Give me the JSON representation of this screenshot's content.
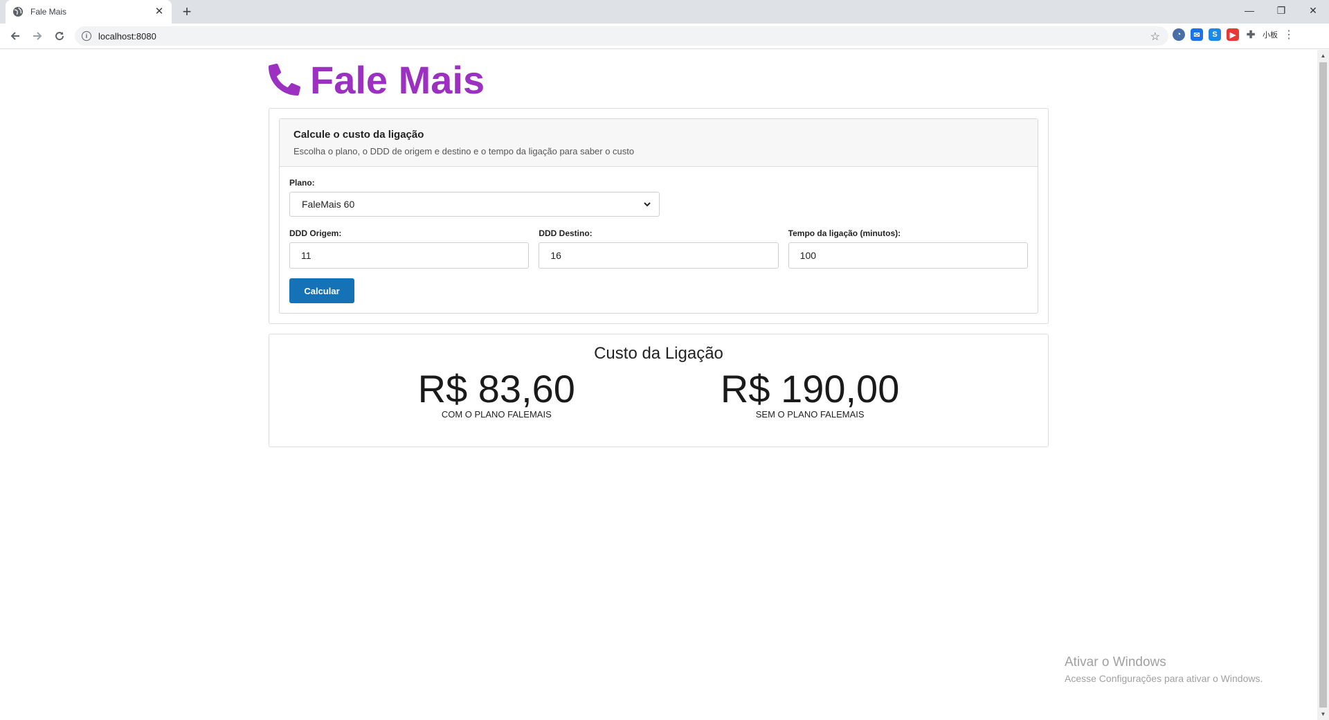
{
  "browser": {
    "tab_title": "Fale Mais",
    "url": "localhost:8080",
    "extension_label": "小板"
  },
  "header": {
    "title": "Fale Mais",
    "brand_color": "#9b30c1"
  },
  "form": {
    "title": "Calcule o custo da ligação",
    "subtitle": "Escolha o plano, o DDD de origem e destino e o tempo da ligação para saber o custo",
    "plan_label": "Plano:",
    "plan_value": "FaleMais 60",
    "origin_label": "DDD Origem:",
    "origin_value": "11",
    "dest_label": "DDD Destino:",
    "dest_value": "16",
    "time_label": "Tempo da ligação (minutos):",
    "time_value": "100",
    "submit_label": "Calcular",
    "button_color": "#1572b6"
  },
  "result": {
    "title": "Custo da Ligação",
    "with_plan_value": "R$ 83,60",
    "with_plan_caption": "COM O PLANO FALEMAIS",
    "without_plan_value": "R$ 190,00",
    "without_plan_caption": "SEM O PLANO FALEMAIS"
  },
  "watermark": {
    "title": "Ativar o Windows",
    "subtitle": "Acesse Configurações para ativar o Windows."
  }
}
